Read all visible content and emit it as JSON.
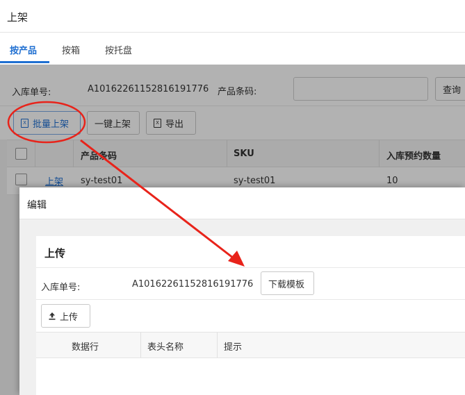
{
  "title": "上架",
  "tabs": [
    {
      "label": "按产品",
      "active": true
    },
    {
      "label": "按箱",
      "active": false
    },
    {
      "label": "按托盘",
      "active": false
    }
  ],
  "form": {
    "inbound_no_label": "入库单号:",
    "inbound_no_value": "A10162261152816191776",
    "product_code_label": "产品条码:",
    "product_code_value": "",
    "search_button": "查询"
  },
  "toolbar": {
    "batch_shelve": "批量上架",
    "one_click_shelve": "一键上架",
    "export": "导出"
  },
  "table": {
    "headers": [
      "产品条码",
      "SKU",
      "入库预约数量"
    ],
    "rows": [
      {
        "action": "上架",
        "product_code": "sy-test01",
        "sku": "sy-test01",
        "qty": "10"
      }
    ]
  },
  "modal": {
    "title": "编辑",
    "panel_title": "上传",
    "inbound_no_label": "入库单号:",
    "inbound_no_value": "A10162261152816191776",
    "download_template": "下载模板",
    "upload_button": "上传",
    "upload_headers": [
      "数据行",
      "表头名称",
      "提示"
    ]
  },
  "colors": {
    "accent": "#1f6fd1",
    "annotation_red": "#e8231a"
  }
}
